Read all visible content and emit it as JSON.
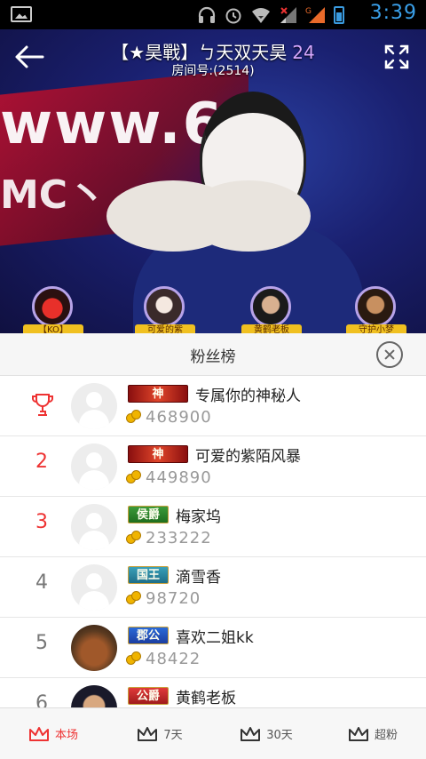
{
  "status_bar": {
    "time": "3:39"
  },
  "room": {
    "title": "【★昊戰】ㄅ天双天昊",
    "viewer_count": "24",
    "room_number": "房间号:(2514)"
  },
  "fans": [
    {
      "name": "【KO】"
    },
    {
      "name": "可爱的紫"
    },
    {
      "name": "黄鹤老板"
    },
    {
      "name": "守护小梦"
    }
  ],
  "board": {
    "title": "粉丝榜",
    "rows": [
      {
        "rank": "",
        "badge": "神",
        "name": "专属你的神秘人",
        "score": "468900"
      },
      {
        "rank": "2",
        "badge": "神",
        "name": "可爱的紫陌风暴",
        "score": "449890"
      },
      {
        "rank": "3",
        "badge": "侯爵",
        "name": "梅家坞",
        "score": "233222"
      },
      {
        "rank": "4",
        "badge": "国王",
        "name": "滴雪香",
        "score": "98720"
      },
      {
        "rank": "5",
        "badge": "郡公",
        "name": "喜欢二姐kk",
        "score": "48422"
      },
      {
        "rank": "6",
        "badge": "公爵",
        "name": "黄鹤老板",
        "score": ""
      }
    ]
  },
  "tabs": [
    {
      "label": "本场"
    },
    {
      "label": "7天"
    },
    {
      "label": "30天"
    },
    {
      "label": "超粉"
    }
  ],
  "colors": {
    "accent": "#e33333",
    "time": "#3aa0ea"
  }
}
